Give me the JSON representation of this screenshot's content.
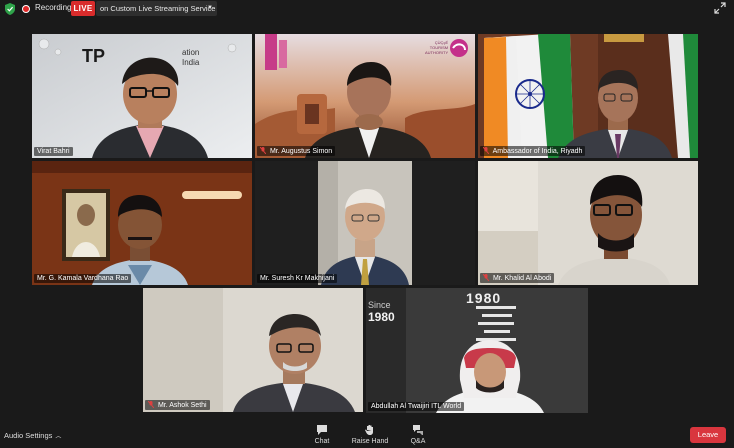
{
  "topbar": {
    "security_icon": "shield-check-icon",
    "recording_label": "Recording",
    "live_label": "LIVE",
    "stream_service_label": "on Custom Live Streaming Service",
    "fullscreen_icon": "expand-arrows-icon"
  },
  "participants": [
    {
      "name": "Virat Bahri",
      "muted": false,
      "backdrop_text": "TP",
      "backdrop_text2": "ation",
      "backdrop_text3": "India"
    },
    {
      "name": "Mr. Augustus Simon",
      "muted": true,
      "backdrop_text": "ÇÙÇçÉ\nTOURISM\nAUTHORITY"
    },
    {
      "name": "Ambassador of India, Riyadh",
      "muted": true
    },
    {
      "name": "Mr. G. Kamala Vardhana Rao",
      "muted": false
    },
    {
      "name": "Mr. Suresh Kr Makhijani",
      "muted": false
    },
    {
      "name": "Mr. Khalid Al Abodi",
      "muted": true
    },
    {
      "name": "Mr. Ashok Sethi",
      "muted": true
    },
    {
      "name": "Abdullah Al Twaijiri ITL World",
      "muted": false,
      "active_speaker": true,
      "backdrop_text": "1980",
      "backdrop_text2": "Since",
      "backdrop_text3": "1980"
    }
  ],
  "bottombar": {
    "audio_settings_label": "Audio Settings",
    "chat_label": "Chat",
    "raise_hand_label": "Raise Hand",
    "qa_label": "Q&A",
    "leave_label": "Leave"
  },
  "colors": {
    "live": "#d92c2c",
    "leave": "#d9363e",
    "active_speaker": "#c8e04a",
    "background": "#1a1a1a"
  }
}
